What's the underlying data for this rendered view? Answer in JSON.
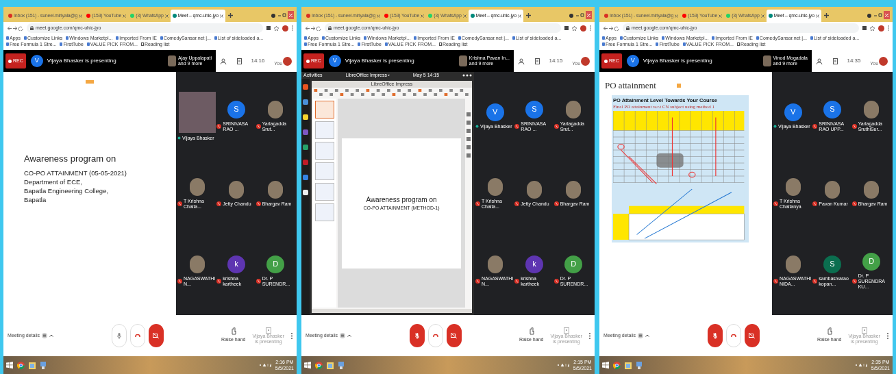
{
  "panels": [
    {
      "tabs": [
        {
          "label": "Inbox (151) - suneel.miriyala@g",
          "selected": false,
          "color": "#d93025"
        },
        {
          "label": "(153) YouTube",
          "selected": false,
          "color": "#ff0000"
        },
        {
          "label": "(3) WhatsApp",
          "selected": false,
          "color": "#25d366"
        },
        {
          "label": "Meet – qmc-uhic-jyo",
          "selected": true,
          "color": "#00897b"
        }
      ],
      "url": "meet.google.com/qmc-uhic-jyo",
      "bookmarks": [
        "Apps",
        "Customize Links",
        "Windows Marketpl...",
        "Imported From IE",
        "ComedySansar.net |...",
        "List of sideloaded a...",
        "Free Formula 1 Stre...",
        "FirstTube",
        "VALUE PICK FROM..."
      ],
      "reading_list": "Reading list",
      "rec": "REC",
      "presenter_initial": "V",
      "presenting": "Vijaya Bhasker is presenting",
      "others": [
        "Ajay Uppalapati",
        "and 9 more"
      ],
      "time": "14:16",
      "you": "You",
      "slide": {
        "kind": "text",
        "lines": [
          "Awareness program on",
          "CO-PO ATTAINMENT (05-05-2021)",
          "Department of ECE,",
          "Bapatla Engineering College,",
          "Bapatla"
        ]
      },
      "participants": [
        {
          "name": "Vijaya Bhasker",
          "kind": "video",
          "muted": false
        },
        {
          "name": "SRINIVASA RAO ...",
          "kind": "letter",
          "initial": "S",
          "color": "#1a73e8",
          "muted": true
        },
        {
          "name": "Yarlagadda Srut...",
          "kind": "photo",
          "muted": true
        },
        {
          "name": "T Krishna Chaita...",
          "kind": "photo",
          "muted": true
        },
        {
          "name": "Jetty Chandu",
          "kind": "photo",
          "muted": true
        },
        {
          "name": "Bhargav Ram",
          "kind": "photo",
          "muted": true
        },
        {
          "name": "NAGASWATHI N...",
          "kind": "photo",
          "muted": true
        },
        {
          "name": "krishna kartheek",
          "kind": "letter",
          "initial": "k",
          "color": "#5e35b1",
          "muted": true
        },
        {
          "name": "Dr. P SURENDR...",
          "kind": "letter",
          "initial": "D",
          "color": "#43a047",
          "muted": true
        }
      ],
      "meeting_details": "Meeting details",
      "mic_muted": false,
      "raise_hand": "Raise hand",
      "present_note": [
        "Vijaya Bhasker",
        "is presenting"
      ],
      "clock": [
        "2:16 PM",
        "5/5/2021"
      ]
    },
    {
      "tabs": [
        {
          "label": "Inbox (151) - suneel.miriyala@g",
          "selected": false,
          "color": "#d93025"
        },
        {
          "label": "(153) YouTube",
          "selected": false,
          "color": "#ff0000"
        },
        {
          "label": "(3) WhatsApp",
          "selected": false,
          "color": "#25d366"
        },
        {
          "label": "Meet – qmc-uhic-jyo",
          "selected": true,
          "color": "#00897b"
        }
      ],
      "url": "meet.google.com/qmc-uhic-jyo",
      "bookmarks": [
        "Apps",
        "Customize Links",
        "Windows Marketpl...",
        "Imported From IE",
        "ComedySansar.net |...",
        "List of sideloaded a...",
        "Free Formula 1 Stre...",
        "FirstTube",
        "VALUE PICK FROM..."
      ],
      "reading_list": "Reading list",
      "rec": "REC",
      "presenter_initial": "V",
      "presenting": "Vijaya Bhasker is presenting",
      "others": [
        "Krishna Pavan In...",
        "and 9 more"
      ],
      "time": "14:15",
      "you": "You",
      "slide": {
        "kind": "app_window",
        "topbar": [
          "Activities",
          "LibreOffice Impress",
          "May 5  14:15"
        ],
        "app_title": "LibreOffice Impress",
        "lines": [
          "Awareness program on",
          "CO-PO ATTAINMENT (METHOD-1)"
        ]
      },
      "participants": [
        {
          "name": "Vijaya Bhasker",
          "kind": "letter",
          "initial": "V",
          "color": "#1a73e8",
          "muted": false
        },
        {
          "name": "SRINIVASA RAO ...",
          "kind": "letter",
          "initial": "S",
          "color": "#1a73e8",
          "muted": true
        },
        {
          "name": "Yarlagadda Srut...",
          "kind": "photo",
          "muted": true
        },
        {
          "name": "T Krishna Chaita...",
          "kind": "photo",
          "muted": true
        },
        {
          "name": "Jetty Chandu",
          "kind": "photo",
          "muted": true
        },
        {
          "name": "Bhargav Ram",
          "kind": "photo",
          "muted": true
        },
        {
          "name": "NAGASWATHI N...",
          "kind": "photo",
          "muted": true
        },
        {
          "name": "krishna kartheek",
          "kind": "letter",
          "initial": "k",
          "color": "#5e35b1",
          "muted": true
        },
        {
          "name": "Dr. P SURENDR...",
          "kind": "letter",
          "initial": "D",
          "color": "#43a047",
          "muted": true
        }
      ],
      "meeting_details": "Meeting details",
      "mic_muted": true,
      "raise_hand": "Raise hand",
      "present_note": [
        "Vijaya Bhasker",
        "is presenting"
      ],
      "clock": [
        "2:15 PM",
        "5/5/2021"
      ]
    },
    {
      "tabs": [
        {
          "label": "Inbox (151) - suneel.miriyala@g",
          "selected": false,
          "color": "#d93025"
        },
        {
          "label": "(153) YouTube",
          "selected": false,
          "color": "#ff0000"
        },
        {
          "label": "(3) WhatsApp",
          "selected": false,
          "color": "#25d366"
        },
        {
          "label": "Meet – qmc-uhic-jyo",
          "selected": true,
          "color": "#00897b"
        }
      ],
      "url": "meet.google.com/qmc-uhic-jyo",
      "bookmarks": [
        "Apps",
        "Customize Links",
        "Windows Marketpl...",
        "Imported From IE",
        "ComedySansar.net |...",
        "List of sideloaded a...",
        "Free Formula 1 Stre...",
        "FirstTube",
        "VALUE PICK FROM..."
      ],
      "reading_list": "Reading list",
      "rec": "REC",
      "presenter_initial": "V",
      "presenting": "Vijaya Bhasker is presenting",
      "others": [
        "Vinod Mogadala",
        "and 9 more"
      ],
      "time": "14:35",
      "you": "You",
      "slide": {
        "kind": "table_slide",
        "title": "PO attainment",
        "heading": "PO Attainment Level Towards Your Course",
        "bullet": "Final PO attainment w.r.t CN subject using method 1"
      },
      "participants": [
        {
          "name": "Vijaya Bhasker",
          "kind": "letter",
          "initial": "V",
          "color": "#1a73e8",
          "muted": false
        },
        {
          "name": "SRINIVASA RAO UPP...",
          "kind": "letter",
          "initial": "S",
          "color": "#1a73e8",
          "muted": true
        },
        {
          "name": "Yarlagadda SruthiSur...",
          "kind": "photo",
          "muted": true
        },
        {
          "name": "T Krishna Chaitanya",
          "kind": "photo",
          "muted": true
        },
        {
          "name": "Pavan Kumar",
          "kind": "photo",
          "muted": true
        },
        {
          "name": "Bhargav Ram",
          "kind": "photo",
          "muted": true
        },
        {
          "name": "NAGASWATHI NIDA...",
          "kind": "photo",
          "muted": true
        },
        {
          "name": "sambasivarao kopan...",
          "kind": "letter",
          "initial": "S",
          "color": "#0b6e4f",
          "muted": true
        },
        {
          "name": "Dr. P SURENDRA KU...",
          "kind": "letter",
          "initial": "D",
          "color": "#43a047",
          "muted": true
        }
      ],
      "meeting_details": "Meeting details",
      "mic_muted": true,
      "raise_hand": "Raise hand",
      "present_note": [
        "Vijaya Bhasker",
        "is presenting"
      ],
      "clock": [
        "2:35 PM",
        "5/5/2021"
      ]
    }
  ]
}
